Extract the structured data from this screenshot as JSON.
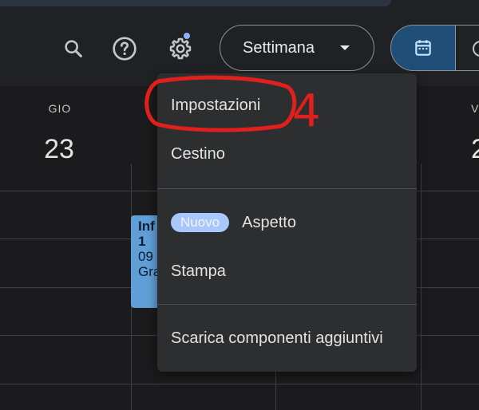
{
  "toolbar": {
    "search_icon": "search-icon",
    "help_icon": "help-icon",
    "settings_icon": "gear-icon",
    "view_selector_label": "Settimana",
    "calendar_view_icon": "calendar-icon"
  },
  "grid": {
    "day_name": "GIO",
    "day_number": "23",
    "next_day_name": "V",
    "next_day_number": "2"
  },
  "event": {
    "title": "Inf",
    "line1": "1",
    "line2": "09",
    "line3": "Gra"
  },
  "settings_menu": {
    "items": [
      {
        "label": "Impostazioni"
      },
      {
        "label": "Cestino"
      },
      {
        "label": "Aspetto",
        "badge": "Nuovo"
      },
      {
        "label": "Stampa"
      },
      {
        "label": "Scarica componenti aggiuntivi"
      }
    ]
  },
  "annotation": {
    "step_number": "4",
    "color": "#e0201c"
  },
  "colors": {
    "accent": "#8ab4f8",
    "selected_view_bg": "#1f4e79",
    "event_bg": "#5f9ed6",
    "menu_bg": "#2d2e30"
  }
}
